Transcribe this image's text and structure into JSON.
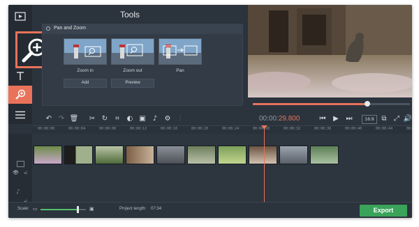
{
  "panel": {
    "title": "Tools",
    "group_label": "Pan and Zoom",
    "presets": [
      {
        "label": "Zoom in",
        "icon": "zoom-in-icon"
      },
      {
        "label": "Zoom out",
        "icon": "zoom-out-icon"
      },
      {
        "label": "Pan",
        "icon": "pan-icon"
      }
    ],
    "buttons": {
      "add": "Add",
      "preview": "Preview"
    }
  },
  "rail": {
    "items": [
      "media-icon",
      "text-icon",
      "zoom-tool-icon",
      "menu-icon"
    ],
    "active": "zoom-tool-icon",
    "accent": "#e8735a"
  },
  "player": {
    "time_elapsed": "00:00:",
    "time_elapsed_red": "29.800",
    "seek_progress": 0.73,
    "aspect_label": "16:9"
  },
  "ruler": {
    "ticks": [
      "00:00:00",
      "00:00:04",
      "00:00:08",
      "00:00:12",
      "00:00:16",
      "00:00:20",
      "00:00:24",
      "00:00:28",
      "00:00:32",
      "00:00:36",
      "00:00:40",
      "00:00:44",
      "00:00:48"
    ]
  },
  "bottom": {
    "scale_label": "Scale:",
    "scale_level": 0.82,
    "project_length_label": "Project length:",
    "project_length_value": "07:34",
    "export_label": "Export",
    "export_color": "#3aa35a"
  }
}
